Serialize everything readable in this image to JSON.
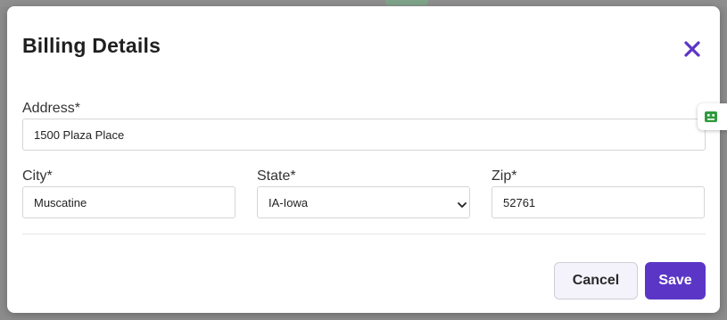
{
  "modal": {
    "title": "Billing Details",
    "close_icon": "close-icon",
    "accent_color": "#5b36c6"
  },
  "form": {
    "address": {
      "label": "Address*",
      "value": "1500 Plaza Place"
    },
    "city": {
      "label": "City*",
      "value": "Muscatine"
    },
    "state": {
      "label": "State*",
      "value": "IA-Iowa",
      "options": [
        "IA-Iowa"
      ]
    },
    "zip": {
      "label": "Zip*",
      "value": "52761"
    }
  },
  "actions": {
    "cancel_label": "Cancel",
    "save_label": "Save"
  },
  "side_widget": {
    "icon": "robot-icon",
    "color": "#2e9b3b"
  }
}
